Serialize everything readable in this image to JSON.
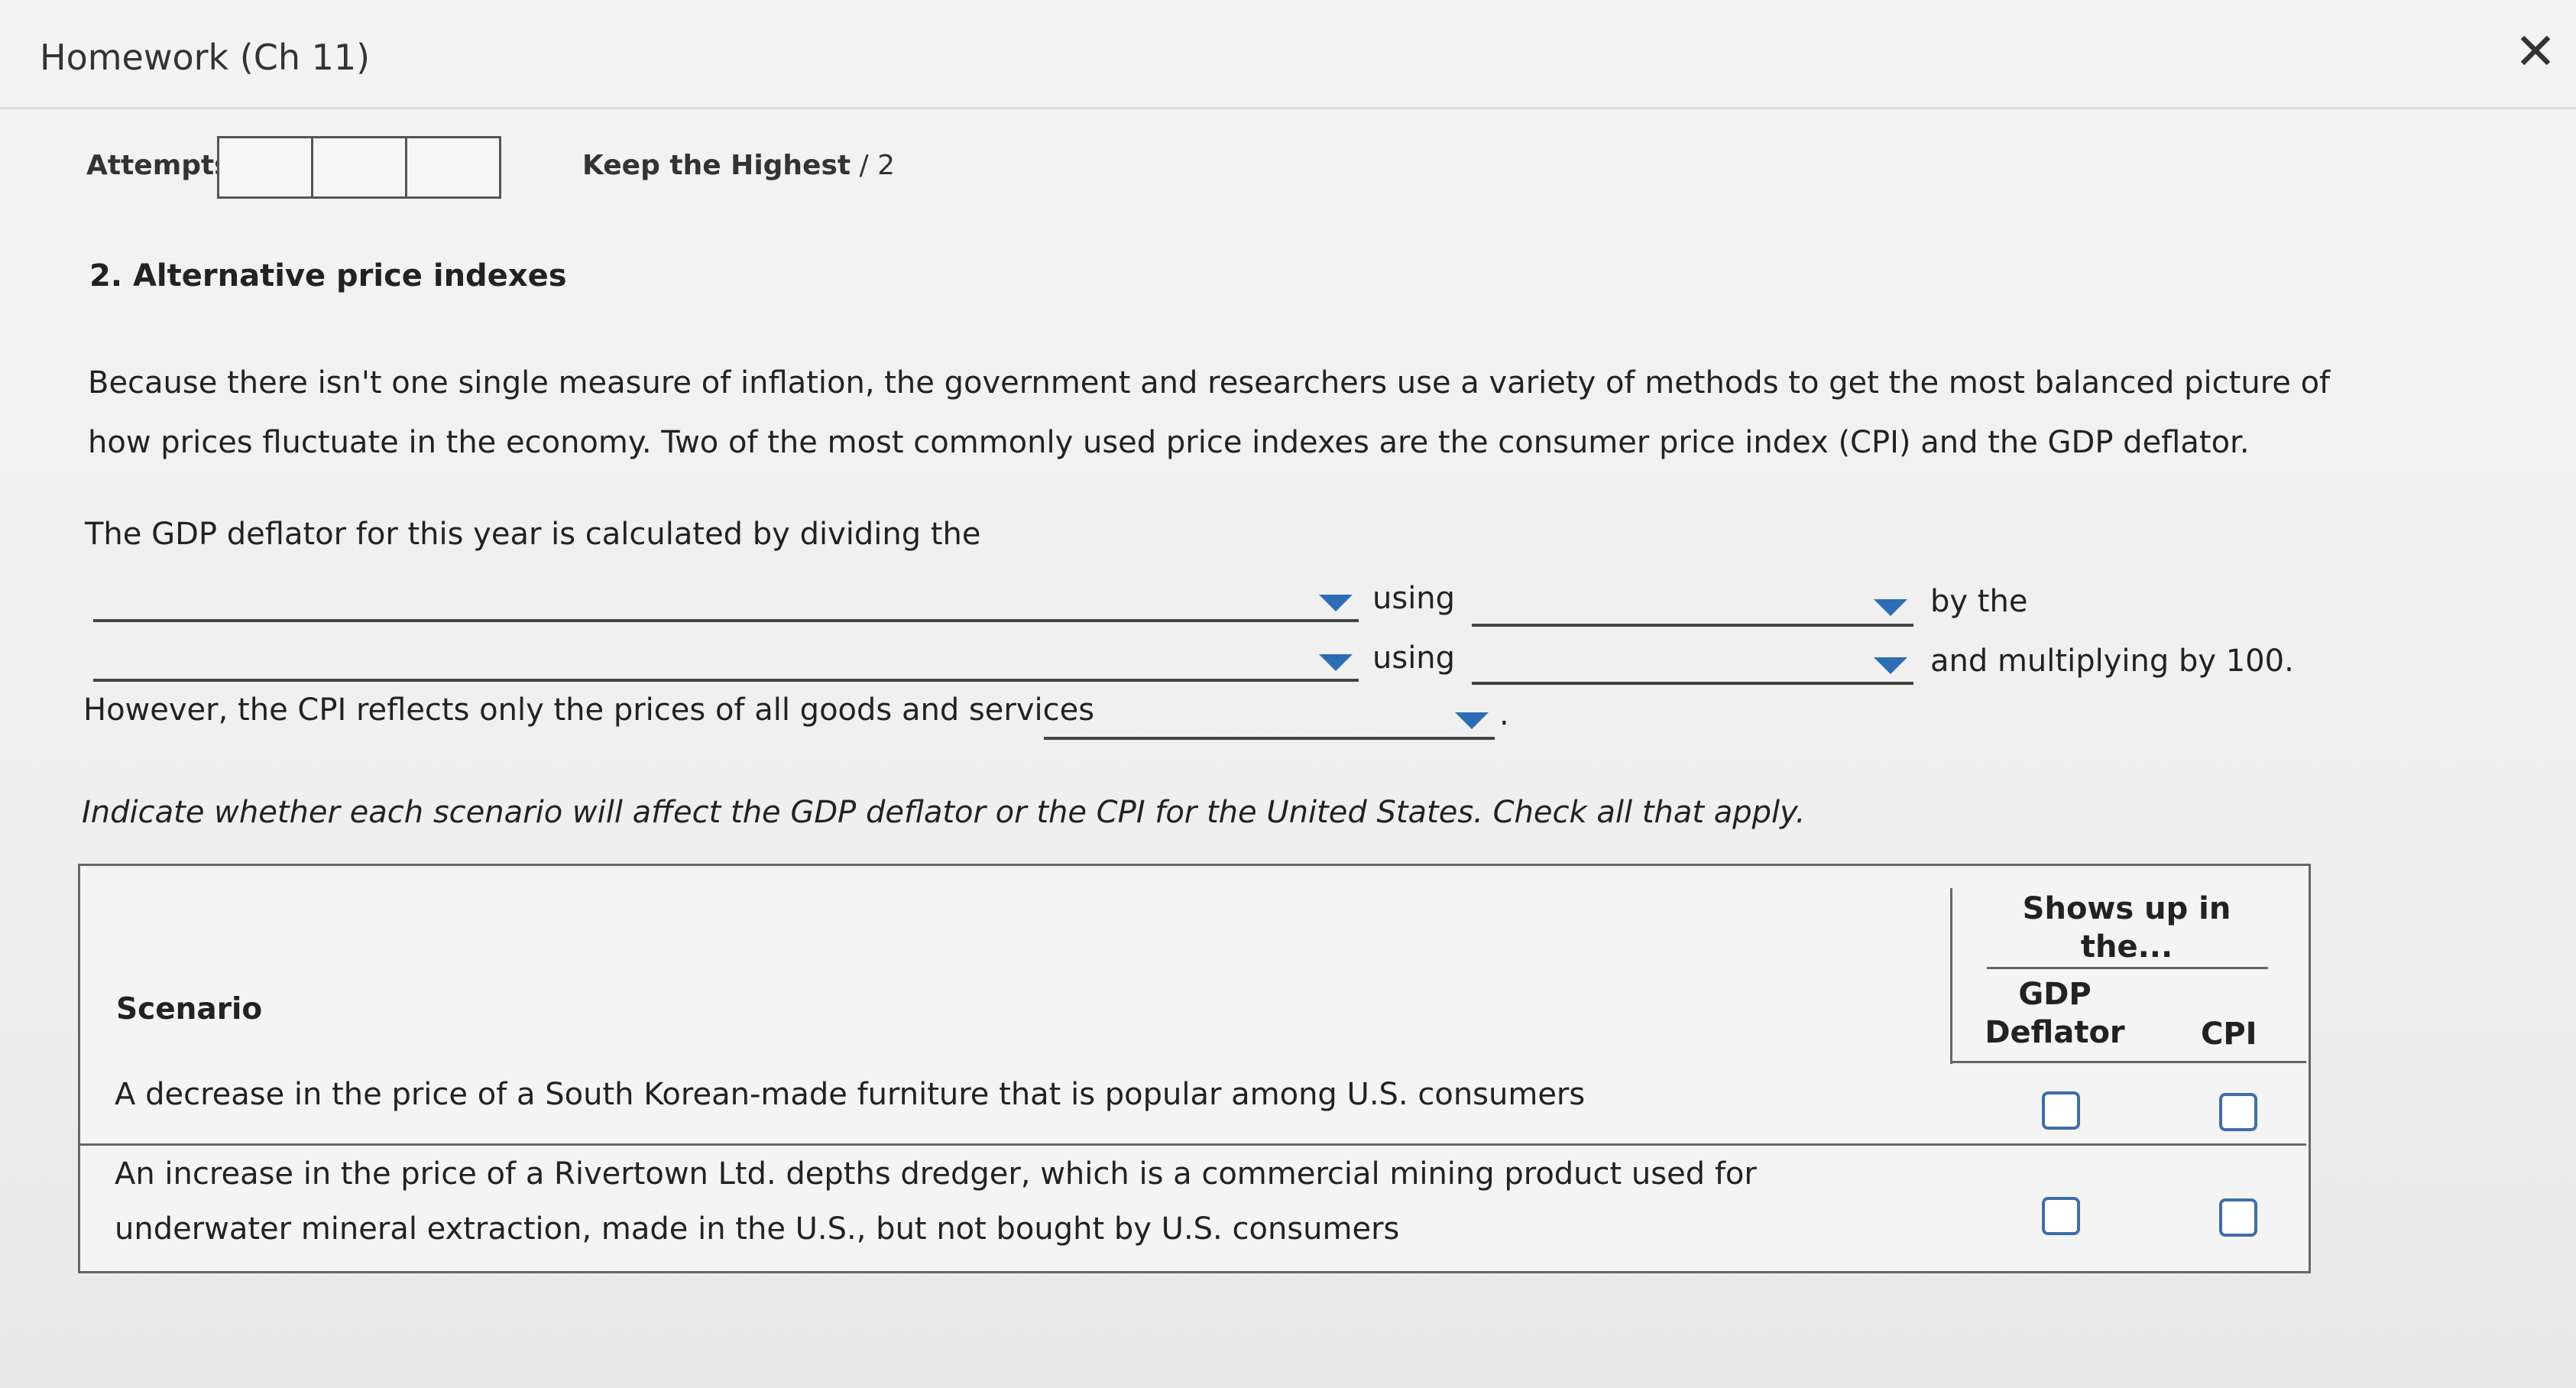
{
  "header": {
    "title": "Homework (Ch 11)",
    "close_icon": "close-icon"
  },
  "attempts": {
    "label": "Attempts",
    "boxes": 3,
    "keep_bold": "Keep the Highest",
    "keep_rest": " / 2"
  },
  "question": {
    "title": "2. Alternative price indexes",
    "intro": "Because there isn't one single measure of inflation, the government and researchers use a variety of methods to get the most balanced picture of how prices fluctuate in the economy. Two of the most commonly used price indexes are the consumer price index (CPI) and the GDP deflator.",
    "gdp_sentence": "The GDP deflator for this year is calculated by dividing the",
    "using1": "using",
    "by_the": "by the",
    "using2": "using",
    "multiply": "and multiplying by 100.",
    "cpi_sentence": "However, the CPI reflects only the prices of all goods and services",
    "period": ".",
    "instruction": "Indicate whether each scenario will affect the GDP deflator or the CPI for the United States. Check all that apply."
  },
  "table": {
    "scenario_header": "Scenario",
    "shows_header": "Shows up in the...",
    "col_gdp": "GDP Deflator",
    "col_cpi": "CPI",
    "rows": [
      {
        "text": "A decrease in the price of a South Korean-made furniture that is popular among U.S. consumers"
      },
      {
        "text": "An increase in the price of a Rivertown Ltd. depths dredger, which is a commercial mining product used for underwater mineral extraction, made in the U.S., but not bought by U.S. consumers"
      }
    ]
  }
}
